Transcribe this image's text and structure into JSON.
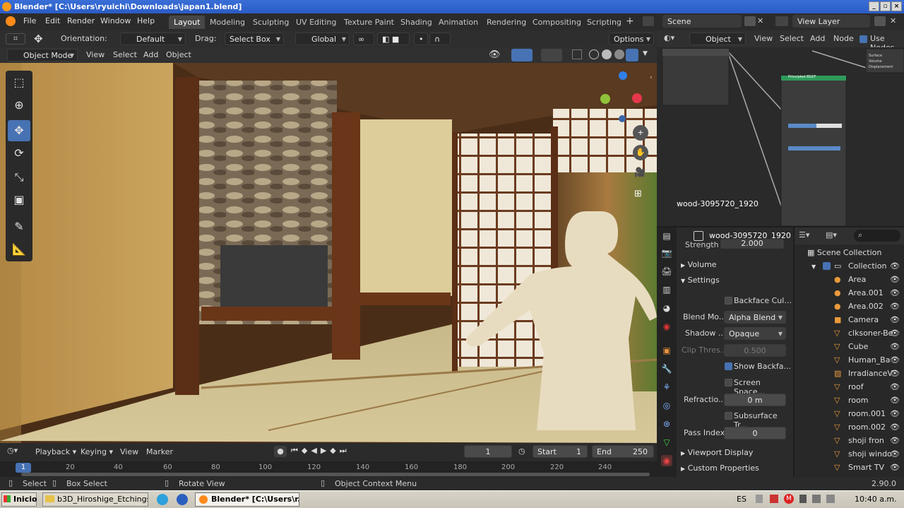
{
  "window": {
    "title": "Blender* [C:\\Users\\ryuichi\\Downloads\\japan1.blend]"
  },
  "menu": [
    "File",
    "Edit",
    "Render",
    "Window",
    "Help"
  ],
  "workspaces": [
    "Layout",
    "Modeling",
    "Sculpting",
    "UV Editing",
    "Texture Paint",
    "Shading",
    "Animation",
    "Rendering",
    "Compositing",
    "Scripting"
  ],
  "active_workspace": "Layout",
  "scene": "Scene",
  "view_layer": "View Layer",
  "toolhdr": {
    "orientation_label": "Orientation:",
    "orientation": "Default",
    "drag_label": "Drag:",
    "drag": "Select Box",
    "transform": "Global",
    "options": "Options"
  },
  "vphdr": {
    "mode": "Object Mode",
    "view": "View",
    "select": "Select",
    "add": "Add",
    "object": "Object"
  },
  "nodehdr": {
    "object": "Object",
    "view": "View",
    "select": "Select",
    "add": "Add",
    "node": "Node",
    "use_nodes": "Use Nodes"
  },
  "node_editor": {
    "image_label": "wood-3095720_1920",
    "node_title": "Principled BSDF",
    "out_labels": [
      "Surface",
      "Volume",
      "Displacement"
    ]
  },
  "props": {
    "object_name": "wood-3095720_1920",
    "strength_label": "Strength",
    "strength": "2.000",
    "volume": "Volume",
    "settings": "Settings",
    "backface": "Backface Cul...",
    "blend_label": "Blend Mo...",
    "blend": "Alpha Blend",
    "shadow_label": "Shadow ...",
    "shadow": "Opaque",
    "clip_label": "Clip Thres...",
    "clip": "0.500",
    "show_backface": "Show Backfa...",
    "screen_space": "Screen Space...",
    "refraction_label": "Refractio...",
    "refraction": "0 m",
    "subsurface": "Subsurface Tr...",
    "pass_label": "Pass Index",
    "pass": "0",
    "viewport_display": "Viewport Display",
    "custom_props": "Custom Properties"
  },
  "outliner": {
    "root": "Scene Collection",
    "items": [
      "Collection",
      "Area",
      "Area.001",
      "Area.002",
      "Camera",
      "clksoner-Be",
      "Cube",
      "Human_Ba",
      "IrradianceV",
      "roof",
      "room",
      "room.001",
      "room.002",
      "shoji fron",
      "shoji windo",
      "Smart TV"
    ]
  },
  "timeline": {
    "playback": "Playback",
    "keying": "Keying",
    "view": "View",
    "marker": "Marker",
    "frame": "1",
    "start_label": "Start",
    "start": "1",
    "end_label": "End",
    "end": "250",
    "ruler": [
      "1",
      "20",
      "40",
      "60",
      "80",
      "100",
      "120",
      "140",
      "160",
      "180",
      "200",
      "220",
      "240"
    ]
  },
  "status": {
    "select": "Select",
    "box": "Box Select",
    "rotate": "Rotate View",
    "ctx": "Object Context Menu",
    "version": "2.90.0"
  },
  "taskbar": {
    "start": "Inicio",
    "task1": "b3D_Hiroshige_Etchings...",
    "task2": "Blender* [C:\\Users\\r...",
    "lang": "ES",
    "time": "10:40 a.m."
  }
}
